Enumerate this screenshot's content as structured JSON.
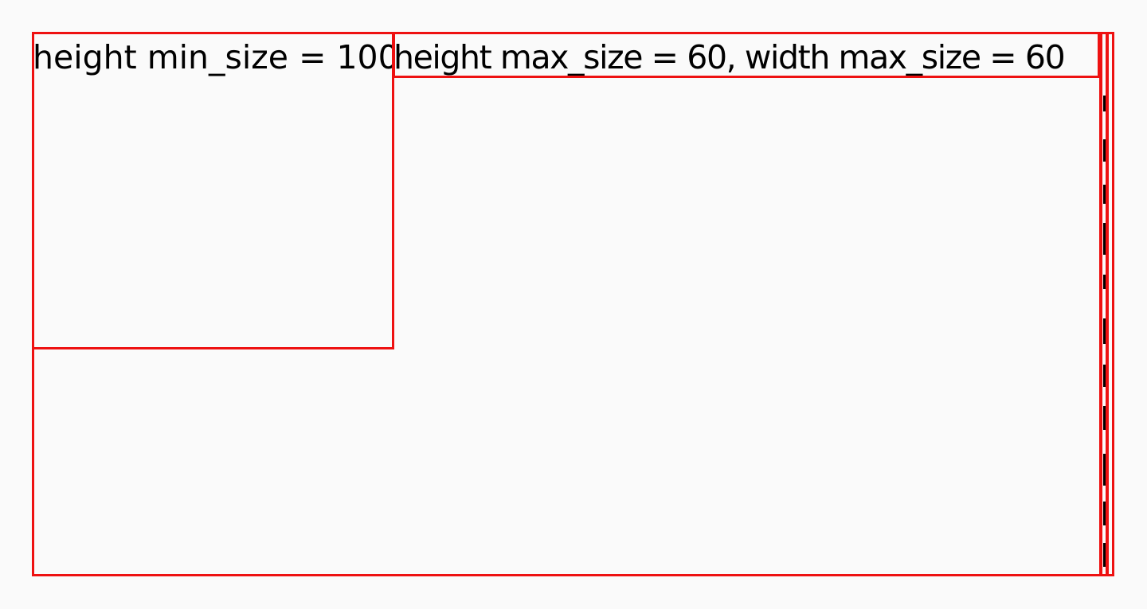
{
  "colors": {
    "background": "#fafafa",
    "box_border": "#ee1111",
    "text": "#000000"
  },
  "boxes": {
    "min_size": {
      "label": "height min_size = 100"
    },
    "max_size": {
      "label": "height max_size = 60, width max_size = 60"
    }
  }
}
